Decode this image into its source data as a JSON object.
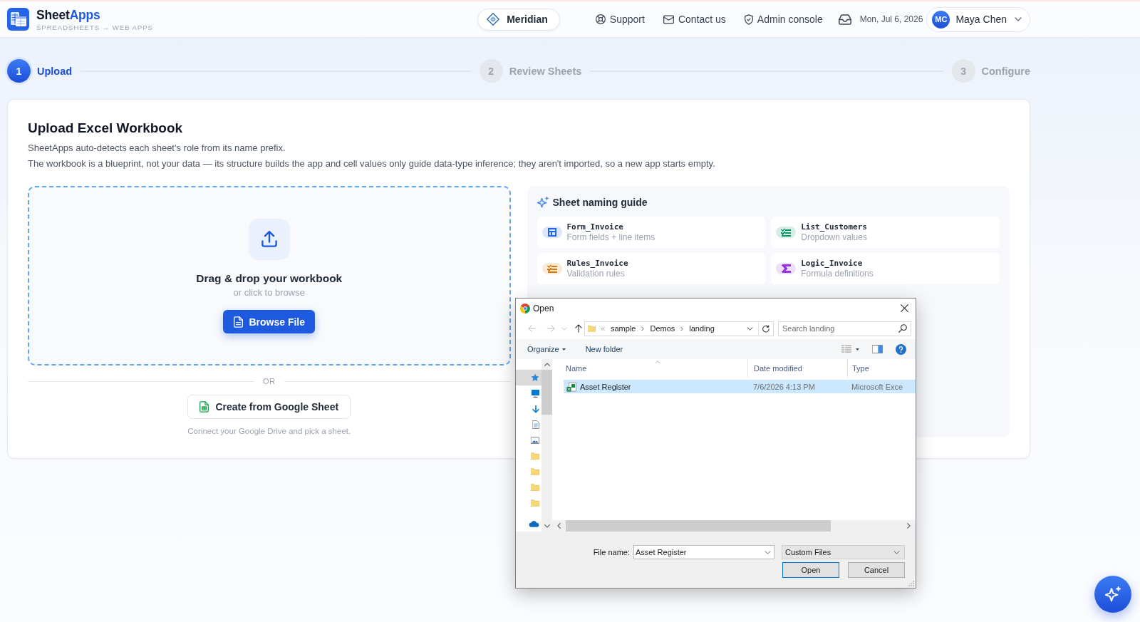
{
  "header": {
    "brand": {
      "name": "Sheet",
      "name_accent": "Apps",
      "tagline": "SPREADSHEETS → WEB APPS"
    },
    "workspace": "Meridian",
    "nav": [
      {
        "kind": "support",
        "label": "Support"
      },
      {
        "kind": "mail",
        "label": "Contact us"
      },
      {
        "kind": "admin",
        "label": "Admin console"
      }
    ],
    "date": "Mon, Jul 6, 2026",
    "user": {
      "initials": "MC",
      "name": "Maya Chen"
    }
  },
  "steps": [
    {
      "number": "1",
      "label": "Upload",
      "active": true
    },
    {
      "number": "2",
      "label": "Review Sheets",
      "active": false
    },
    {
      "number": "3",
      "label": "Configure",
      "active": false
    }
  ],
  "upload_card": {
    "title": "Upload Excel Workbook",
    "description": [
      "SheetApps auto-detects each sheet's role from its name prefix.",
      "The workbook is a blueprint, not your data — its structure builds the app and cell values only guide data-type inference; they aren't imported, so a new app starts empty."
    ],
    "dropzone": {
      "title": "Drag & drop your workbook",
      "subtitle": "or click to browse",
      "button": "Browse File"
    },
    "divider": "OR",
    "google_button": "Create from Google Sheet",
    "google_caption": "Connect your Google Drive and pick a sheet.",
    "naming_guide": {
      "title": "Sheet naming guide",
      "items": [
        {
          "kind": "table",
          "color": "#2563eb",
          "name": "Form_Invoice",
          "description": "Form fields + line items"
        },
        {
          "kind": "checklist",
          "color": "#059669",
          "name": "List_Customers",
          "description": "Dropdown values"
        },
        {
          "kind": "checklist",
          "color": "#d97706",
          "name": "Rules_Invoice",
          "description": "Validation rules"
        },
        {
          "kind": "sigma",
          "color": "#9333ea",
          "name": "Logic_Invoice",
          "description": "Formula definitions"
        }
      ]
    }
  },
  "open_dialog": {
    "title": "Open",
    "path": [
      "sample",
      "Demos",
      "landing"
    ],
    "search_placeholder": "Search landing",
    "toolbar": {
      "organize": "Organize",
      "new_folder": "New folder"
    },
    "nav_pane": [
      {
        "kind": "star",
        "selected": true
      },
      {
        "kind": "desktop",
        "selected": false
      },
      {
        "kind": "download",
        "selected": false
      },
      {
        "kind": "document",
        "selected": false
      },
      {
        "kind": "picture",
        "selected": false
      },
      {
        "kind": "folder",
        "selected": false
      },
      {
        "kind": "folder",
        "selected": false
      },
      {
        "kind": "folder",
        "selected": false
      },
      {
        "kind": "folder",
        "selected": false
      },
      {
        "kind": "cloud",
        "selected": false
      }
    ],
    "columns": [
      "Name",
      "Date modified",
      "Type"
    ],
    "files": [
      {
        "name": "Asset Register",
        "date_modified": "7/6/2026 4:13 PM",
        "type": "Microsoft Exce",
        "selected": true
      }
    ],
    "file_name_label": "File name:",
    "file_name": "Asset Register",
    "file_type": "Custom Files",
    "buttons": [
      {
        "label": "Open",
        "default": true
      },
      {
        "label": "Cancel",
        "default": false
      }
    ]
  }
}
